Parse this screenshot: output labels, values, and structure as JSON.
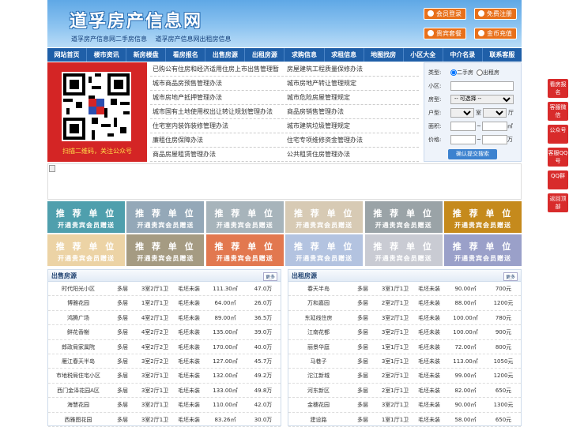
{
  "header": {
    "logo": "道孚房产信息网",
    "sub1": "道孚房产信息网二手房信息",
    "sub2": "道孚房产信息网出租房信息",
    "btn_login": "会员登录",
    "btn_register": "免费注册",
    "btn_package": "贵宾套餐",
    "btn_recharge": "金币充值"
  },
  "nav": [
    "网站首页",
    "楼市资讯",
    "新房楼盘",
    "看房报名",
    "出售房源",
    "出租房源",
    "求购信息",
    "求租信息",
    "地图找房",
    "小区大全",
    "中介名录",
    "联系客服"
  ],
  "qr": {
    "caption": "扫描二维码，关注公众号"
  },
  "links": [
    [
      "已购公有住房和经济适用住房上市出售管理暂",
      "房屋建筑工程质量保修办法"
    ],
    [
      "城市商品房预售管理办法",
      "城市房地产转让管理规定"
    ],
    [
      "城市房地产抵押管理办法",
      "城市危险房屋管理规定"
    ],
    [
      "城市国有土地使用权出让转让规划管理办法",
      "商品房销售管理办法"
    ],
    [
      "住宅室内装饰装修管理办法",
      "城市建筑垃圾管理规定"
    ],
    [
      "廉租住房保障办法",
      "住宅专项维修资金管理办法"
    ],
    [
      "商品房屋租赁管理办法",
      "公共租赁住房管理办法"
    ]
  ],
  "search": {
    "type_label": "类型:",
    "opt1": "二手房",
    "opt2": "出租房",
    "community_label": "小区:",
    "housetype_label": "房型:",
    "housetype_value": "-- 可选择 --",
    "layout_label": "户型:",
    "room": "室",
    "hall": "厅",
    "area_label": "面积:",
    "area_unit": "㎡",
    "price_label": "价格:",
    "price_unit": "万",
    "submit": "确认提交搜索"
  },
  "ads": {
    "line1": "推 荐 单 位",
    "line2": "开通贵宾会员赠送",
    "colors": [
      "#4f9fad",
      "#94a8b8",
      "#a7b4bb",
      "#d7cab4",
      "#9aa3a7",
      "#c58a1c",
      "#ecd3a5",
      "#a59b82",
      "#e2784f",
      "#b3c3e0",
      "#c9cbd3",
      "#9aa0c9"
    ]
  },
  "sale": {
    "title": "出售房源",
    "more": "更多",
    "rows": [
      [
        "时代阳光小区",
        "多层",
        "3室2厅1卫",
        "毛坯未装",
        "111.30㎡",
        "47.0万"
      ],
      [
        "博雅花园",
        "多层",
        "1室2厅1卫",
        "毛坯未装",
        "64.00㎡",
        "26.0万"
      ],
      [
        "鸿腾广场",
        "多层",
        "4室2厅1卫",
        "毛坯未装",
        "89.00㎡",
        "36.5万"
      ],
      [
        "鲜花香榭",
        "多层",
        "4室2厅2卫",
        "毛坯未装",
        "135.00㎡",
        "39.0万"
      ],
      [
        "郎政局家属院",
        "多层",
        "4室2厅2卫",
        "毛坯未装",
        "170.00㎡",
        "40.0万"
      ],
      [
        "雁江春天半岛",
        "多层",
        "3室2厅2卫",
        "毛坯未装",
        "127.00㎡",
        "45.7万"
      ],
      [
        "市地税局住宅小区",
        "多层",
        "3室2厅1卫",
        "毛坯未装",
        "132.00㎡",
        "49.2万"
      ],
      [
        "西门金泽花园A区",
        "多层",
        "3室2厅1卫",
        "毛坯未装",
        "133.00㎡",
        "49.8万"
      ],
      [
        "海慧花园",
        "多层",
        "3室2厅1卫",
        "毛坯未装",
        "110.00㎡",
        "42.0万"
      ],
      [
        "西雅图花园",
        "多层",
        "3室2厅1卫",
        "毛坯未装",
        "83.26㎡",
        "30.0万"
      ]
    ]
  },
  "rent": {
    "title": "出租房源",
    "more": "更多",
    "rows": [
      [
        "春天半岛",
        "多层",
        "3室1厅1卫",
        "毛坯未装",
        "90.00㎡",
        "700元"
      ],
      [
        "万和嘉园",
        "多层",
        "2室2厅1卫",
        "毛坯未装",
        "88.00㎡",
        "1200元"
      ],
      [
        "东延线住房",
        "多层",
        "3室2厅1卫",
        "毛坯未装",
        "100.00㎡",
        "780元"
      ],
      [
        "江南花都",
        "多层",
        "3室2厅1卫",
        "毛坯未装",
        "100.00㎡",
        "900元"
      ],
      [
        "丽景华庭",
        "多层",
        "1室1厅1卫",
        "毛坯未装",
        "72.00㎡",
        "800元"
      ],
      [
        "马巷子",
        "多层",
        "3室1厅1卫",
        "毛坯未装",
        "113.00㎡",
        "1050元"
      ],
      [
        "沱江新城",
        "多层",
        "2室2厅1卫",
        "毛坯未装",
        "99.00㎡",
        "1200元"
      ],
      [
        "河东新区",
        "多层",
        "2室1厅1卫",
        "毛坯未装",
        "82.00㎡",
        "650元"
      ],
      [
        "金穗花园",
        "多层",
        "3室2厅1卫",
        "毛坯未装",
        "90.00㎡",
        "1300元"
      ],
      [
        "建设路",
        "多层",
        "1室1厅1卫",
        "毛坯未装",
        "58.00㎡",
        "650元"
      ]
    ]
  },
  "side": [
    "看房报名",
    "客服微信",
    "公众号",
    "客服QQ号",
    "QQ群",
    "返回顶部"
  ]
}
